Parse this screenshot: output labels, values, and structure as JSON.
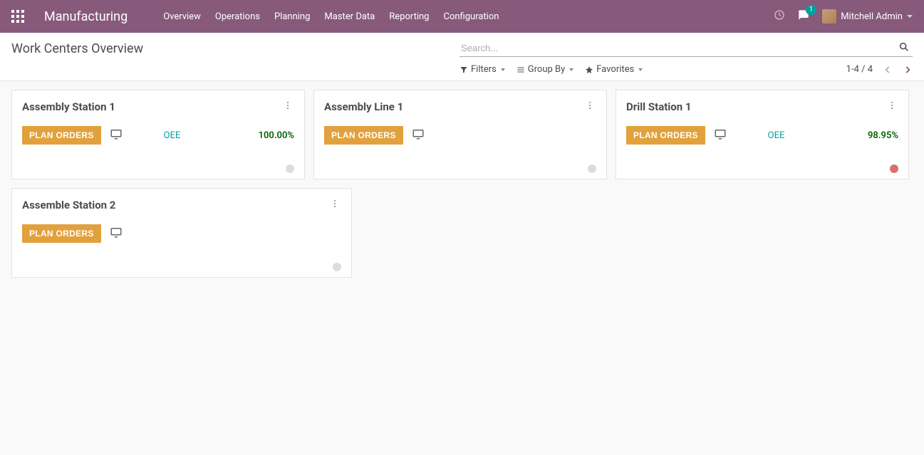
{
  "navbar": {
    "brand": "Manufacturing",
    "menu": [
      "Overview",
      "Operations",
      "Planning",
      "Master Data",
      "Reporting",
      "Configuration"
    ],
    "chat_count": "1",
    "user_name": "Mitchell Admin"
  },
  "control_panel": {
    "page_title": "Work Centers Overview",
    "search_placeholder": "Search...",
    "filters_label": "Filters",
    "group_by_label": "Group By",
    "favorites_label": "Favorites",
    "pager_text": "1-4 / 4"
  },
  "cards": [
    {
      "title": "Assembly Station 1",
      "plan_label": "PLAN ORDERS",
      "oee_label": "OEE",
      "oee_value": "100.00%",
      "has_oee": true,
      "status_color": "grey"
    },
    {
      "title": "Assembly Line 1",
      "plan_label": "PLAN ORDERS",
      "has_oee": false,
      "status_color": "grey"
    },
    {
      "title": "Drill Station 1",
      "plan_label": "PLAN ORDERS",
      "oee_label": "OEE",
      "oee_value": "98.95%",
      "has_oee": true,
      "status_color": "red"
    },
    {
      "title": "Assemble Station 2",
      "plan_label": "PLAN ORDERS",
      "has_oee": false,
      "status_color": "grey"
    }
  ]
}
